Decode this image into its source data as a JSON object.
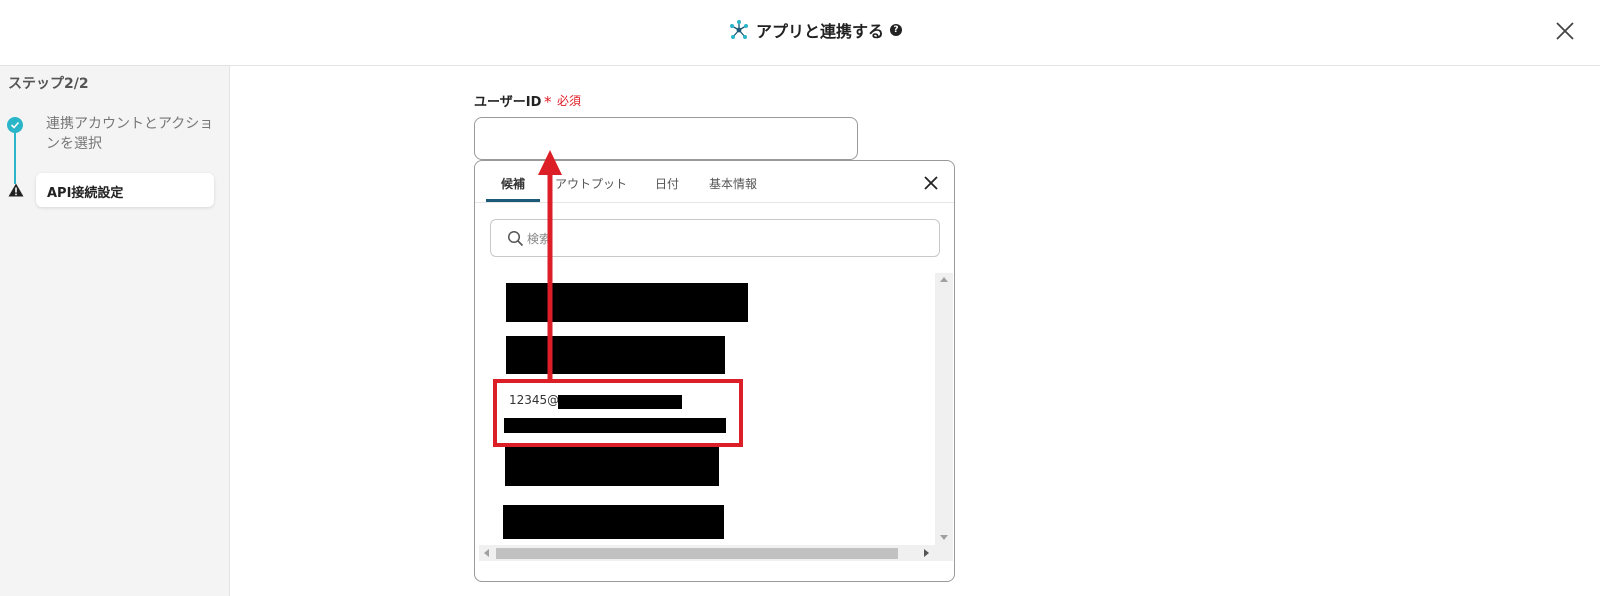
{
  "header": {
    "title": "アプリと連携する",
    "help_glyph": "?",
    "icons": {
      "app": "hub-nodes-icon",
      "help": "question-circle-icon",
      "close": "close-icon"
    }
  },
  "sidebar": {
    "step_heading": "ステップ2/2",
    "steps": [
      {
        "label": "連携アカウントとアクションを選択",
        "status": "completed",
        "icon": "check-icon"
      },
      {
        "label": "API接続設定",
        "status": "warning",
        "icon": "warning-triangle-icon",
        "active": true
      }
    ],
    "accent_color": "#2bb5c8"
  },
  "field": {
    "label": "ユーザーID",
    "required_mark": "*",
    "required_text": "必須",
    "value": "",
    "required_color": "#e0202a"
  },
  "popup": {
    "tabs": [
      {
        "label": "候補",
        "active": true
      },
      {
        "label": "アウトプット",
        "active": false
      },
      {
        "label": "日付",
        "active": false
      },
      {
        "label": "基本情報",
        "active": false
      }
    ],
    "search_placeholder": "検索",
    "items": [
      {
        "text": "",
        "redacted": true
      },
      {
        "text": "",
        "redacted": true
      },
      {
        "text": "12345@",
        "redacted_suffix": true,
        "highlighted": true
      },
      {
        "text": "",
        "redacted": true
      },
      {
        "text": "",
        "redacted": true
      }
    ],
    "annotation_color": "#dc1f26"
  }
}
